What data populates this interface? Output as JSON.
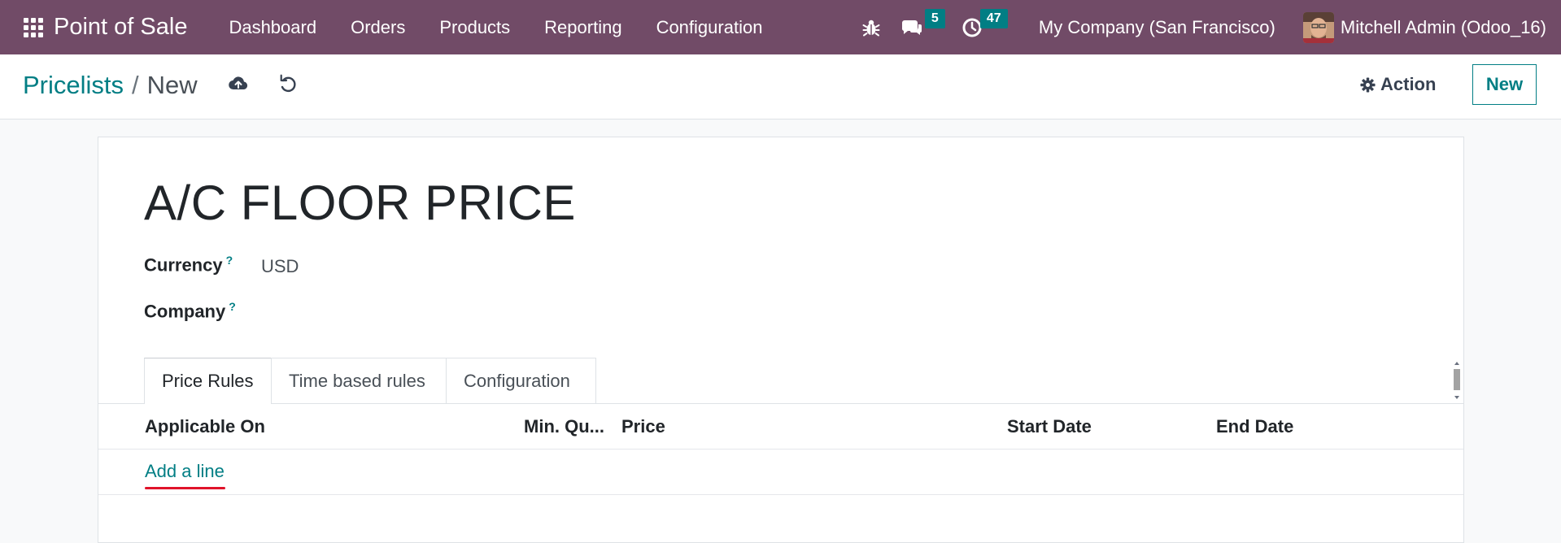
{
  "navbar": {
    "app_name": "Point of Sale",
    "menu": [
      "Dashboard",
      "Orders",
      "Products",
      "Reporting",
      "Configuration"
    ],
    "messages_count": "5",
    "activities_count": "47",
    "company": "My Company (San Francisco)",
    "user": "Mitchell Admin (Odoo_16)"
  },
  "control_panel": {
    "breadcrumb_parent": "Pricelists",
    "breadcrumb_separator": "/",
    "breadcrumb_current": "New",
    "action_label": "Action",
    "new_label": "New"
  },
  "form": {
    "name": "A/C FLOOR PRICE",
    "currency_label": "Currency",
    "currency_help": "?",
    "currency_value": "USD",
    "company_label": "Company",
    "company_help": "?",
    "company_value": ""
  },
  "tabs": [
    "Price Rules",
    "Time based rules",
    "Configuration"
  ],
  "table": {
    "columns": [
      "Applicable On",
      "Min. Qu...",
      "Price",
      "Start Date",
      "End Date"
    ],
    "add_line": "Add a line"
  },
  "colors": {
    "navbar": "#714b67",
    "accent": "#017e84",
    "badge": "#017e84",
    "underline": "#e0132a"
  }
}
